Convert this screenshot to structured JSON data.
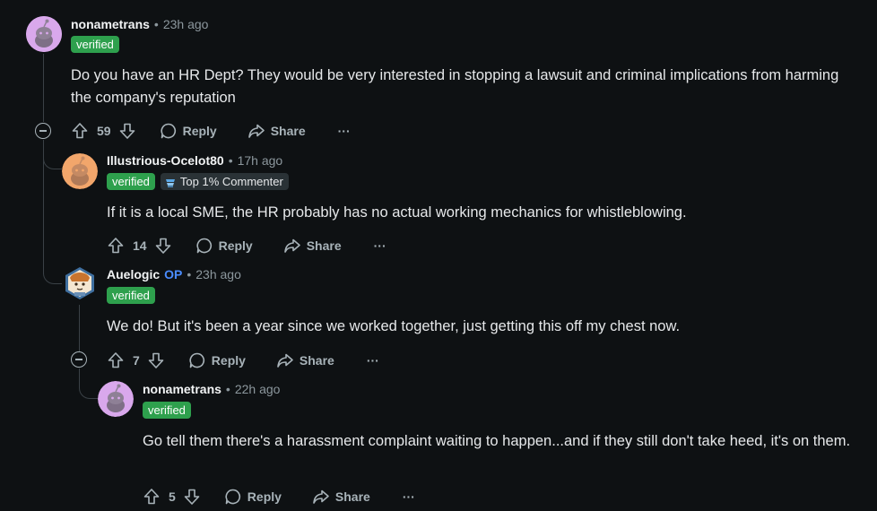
{
  "comments": [
    {
      "username": "nonametrans",
      "time": "23h ago",
      "badge": "verified",
      "body": "Do you have an HR Dept? They would be very interested in stopping a lawsuit and criminal implications from harming the company's reputation",
      "score": "59"
    },
    {
      "username": "Illustrious-Ocelot80",
      "time": "17h ago",
      "badge": "verified",
      "badge2": "Top 1% Commenter",
      "body": "If it is a local SME, the HR probably has no actual working mechanics for whistleblowing.",
      "score": "14"
    },
    {
      "username": "Auelogic",
      "op": "OP",
      "time": "23h ago",
      "badge": "verified",
      "body": "We do! But it's been a year since we worked together, just getting this off my chest now.",
      "score": "7"
    },
    {
      "username": "nonametrans",
      "time": "22h ago",
      "badge": "verified",
      "body": "Go tell them there's a harassment complaint waiting to happen...and if they still don't take heed, it's on them.",
      "score": "5"
    }
  ],
  "actions": {
    "reply": "Reply",
    "share": "Share",
    "more": "···"
  },
  "separator": "•",
  "icons": [
    "upvote-icon",
    "downvote-icon",
    "reply-icon",
    "share-icon",
    "more-icon",
    "collapse-icon",
    "trophy-icon"
  ]
}
